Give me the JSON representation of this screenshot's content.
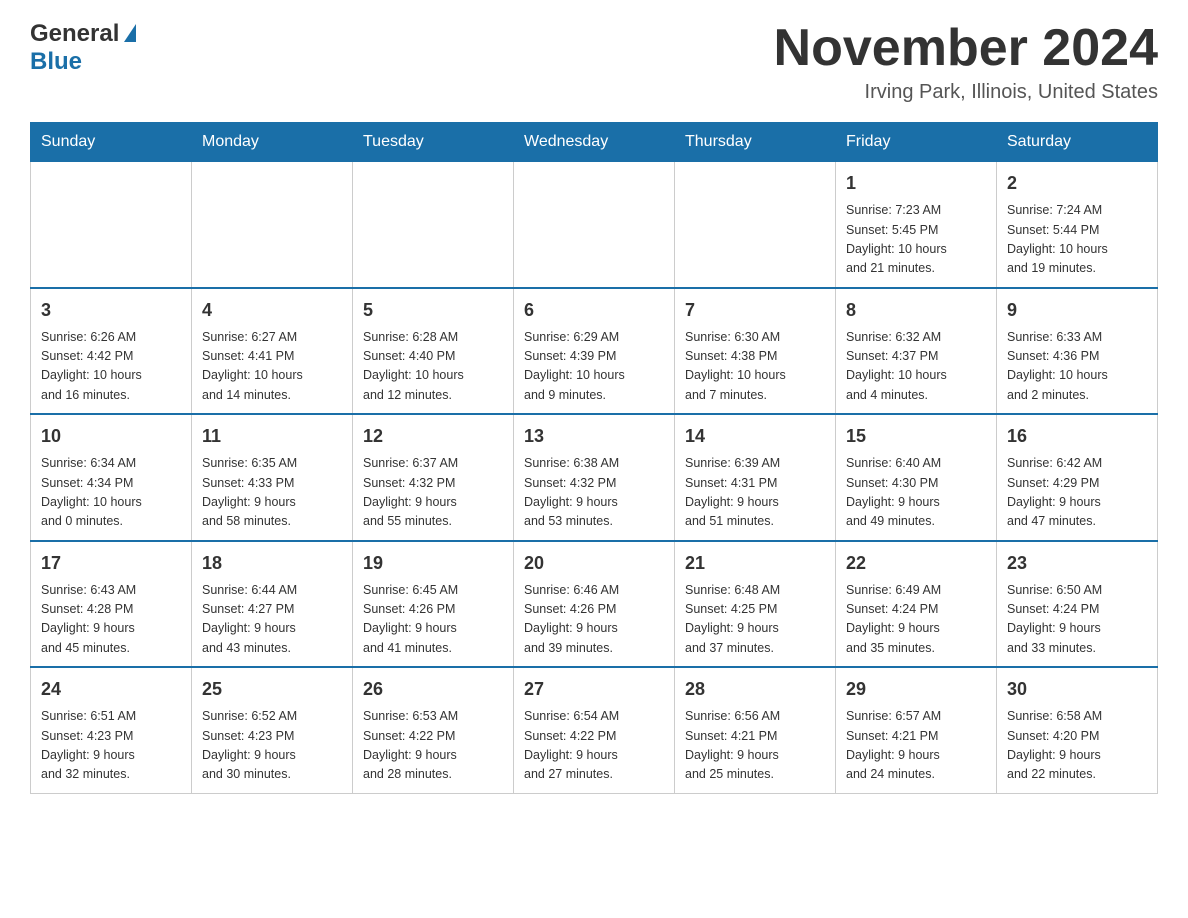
{
  "header": {
    "logo_general": "General",
    "logo_blue": "Blue",
    "month_title": "November 2024",
    "location": "Irving Park, Illinois, United States"
  },
  "weekdays": [
    "Sunday",
    "Monday",
    "Tuesday",
    "Wednesday",
    "Thursday",
    "Friday",
    "Saturday"
  ],
  "weeks": [
    [
      {
        "day": "",
        "info": ""
      },
      {
        "day": "",
        "info": ""
      },
      {
        "day": "",
        "info": ""
      },
      {
        "day": "",
        "info": ""
      },
      {
        "day": "",
        "info": ""
      },
      {
        "day": "1",
        "info": "Sunrise: 7:23 AM\nSunset: 5:45 PM\nDaylight: 10 hours\nand 21 minutes."
      },
      {
        "day": "2",
        "info": "Sunrise: 7:24 AM\nSunset: 5:44 PM\nDaylight: 10 hours\nand 19 minutes."
      }
    ],
    [
      {
        "day": "3",
        "info": "Sunrise: 6:26 AM\nSunset: 4:42 PM\nDaylight: 10 hours\nand 16 minutes."
      },
      {
        "day": "4",
        "info": "Sunrise: 6:27 AM\nSunset: 4:41 PM\nDaylight: 10 hours\nand 14 minutes."
      },
      {
        "day": "5",
        "info": "Sunrise: 6:28 AM\nSunset: 4:40 PM\nDaylight: 10 hours\nand 12 minutes."
      },
      {
        "day": "6",
        "info": "Sunrise: 6:29 AM\nSunset: 4:39 PM\nDaylight: 10 hours\nand 9 minutes."
      },
      {
        "day": "7",
        "info": "Sunrise: 6:30 AM\nSunset: 4:38 PM\nDaylight: 10 hours\nand 7 minutes."
      },
      {
        "day": "8",
        "info": "Sunrise: 6:32 AM\nSunset: 4:37 PM\nDaylight: 10 hours\nand 4 minutes."
      },
      {
        "day": "9",
        "info": "Sunrise: 6:33 AM\nSunset: 4:36 PM\nDaylight: 10 hours\nand 2 minutes."
      }
    ],
    [
      {
        "day": "10",
        "info": "Sunrise: 6:34 AM\nSunset: 4:34 PM\nDaylight: 10 hours\nand 0 minutes."
      },
      {
        "day": "11",
        "info": "Sunrise: 6:35 AM\nSunset: 4:33 PM\nDaylight: 9 hours\nand 58 minutes."
      },
      {
        "day": "12",
        "info": "Sunrise: 6:37 AM\nSunset: 4:32 PM\nDaylight: 9 hours\nand 55 minutes."
      },
      {
        "day": "13",
        "info": "Sunrise: 6:38 AM\nSunset: 4:32 PM\nDaylight: 9 hours\nand 53 minutes."
      },
      {
        "day": "14",
        "info": "Sunrise: 6:39 AM\nSunset: 4:31 PM\nDaylight: 9 hours\nand 51 minutes."
      },
      {
        "day": "15",
        "info": "Sunrise: 6:40 AM\nSunset: 4:30 PM\nDaylight: 9 hours\nand 49 minutes."
      },
      {
        "day": "16",
        "info": "Sunrise: 6:42 AM\nSunset: 4:29 PM\nDaylight: 9 hours\nand 47 minutes."
      }
    ],
    [
      {
        "day": "17",
        "info": "Sunrise: 6:43 AM\nSunset: 4:28 PM\nDaylight: 9 hours\nand 45 minutes."
      },
      {
        "day": "18",
        "info": "Sunrise: 6:44 AM\nSunset: 4:27 PM\nDaylight: 9 hours\nand 43 minutes."
      },
      {
        "day": "19",
        "info": "Sunrise: 6:45 AM\nSunset: 4:26 PM\nDaylight: 9 hours\nand 41 minutes."
      },
      {
        "day": "20",
        "info": "Sunrise: 6:46 AM\nSunset: 4:26 PM\nDaylight: 9 hours\nand 39 minutes."
      },
      {
        "day": "21",
        "info": "Sunrise: 6:48 AM\nSunset: 4:25 PM\nDaylight: 9 hours\nand 37 minutes."
      },
      {
        "day": "22",
        "info": "Sunrise: 6:49 AM\nSunset: 4:24 PM\nDaylight: 9 hours\nand 35 minutes."
      },
      {
        "day": "23",
        "info": "Sunrise: 6:50 AM\nSunset: 4:24 PM\nDaylight: 9 hours\nand 33 minutes."
      }
    ],
    [
      {
        "day": "24",
        "info": "Sunrise: 6:51 AM\nSunset: 4:23 PM\nDaylight: 9 hours\nand 32 minutes."
      },
      {
        "day": "25",
        "info": "Sunrise: 6:52 AM\nSunset: 4:23 PM\nDaylight: 9 hours\nand 30 minutes."
      },
      {
        "day": "26",
        "info": "Sunrise: 6:53 AM\nSunset: 4:22 PM\nDaylight: 9 hours\nand 28 minutes."
      },
      {
        "day": "27",
        "info": "Sunrise: 6:54 AM\nSunset: 4:22 PM\nDaylight: 9 hours\nand 27 minutes."
      },
      {
        "day": "28",
        "info": "Sunrise: 6:56 AM\nSunset: 4:21 PM\nDaylight: 9 hours\nand 25 minutes."
      },
      {
        "day": "29",
        "info": "Sunrise: 6:57 AM\nSunset: 4:21 PM\nDaylight: 9 hours\nand 24 minutes."
      },
      {
        "day": "30",
        "info": "Sunrise: 6:58 AM\nSunset: 4:20 PM\nDaylight: 9 hours\nand 22 minutes."
      }
    ]
  ]
}
